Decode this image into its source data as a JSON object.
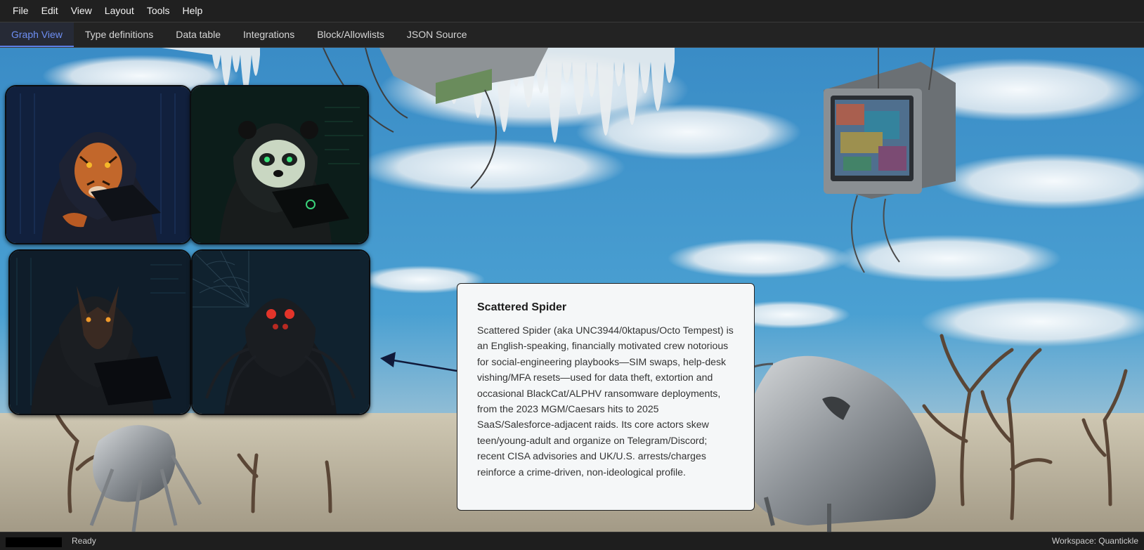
{
  "menu": [
    "File",
    "Edit",
    "View",
    "Layout",
    "Tools",
    "Help"
  ],
  "tabs": [
    {
      "label": "Graph View",
      "active": true
    },
    {
      "label": "Type definitions",
      "active": false
    },
    {
      "label": "Data table",
      "active": false
    },
    {
      "label": "Integrations",
      "active": false
    },
    {
      "label": "Block/Allowlists",
      "active": false
    },
    {
      "label": "JSON Source",
      "active": false
    }
  ],
  "nodes": [
    {
      "name": "tiger-node",
      "icon": "hooded-tiger-hacker-icon"
    },
    {
      "name": "panda-node",
      "icon": "hooded-panda-hacker-icon"
    },
    {
      "name": "wolf-node",
      "icon": "hooded-wolf-hacker-icon"
    },
    {
      "name": "spider-node",
      "icon": "hooded-spider-hacker-icon"
    }
  ],
  "tooltip": {
    "title": "Scattered Spider",
    "body": "Scattered Spider (aka UNC3944/0ktapus/Octo Tempest) is an English-speaking, financially motivated crew notorious for social-engineering playbooks—SIM swaps, help-desk vishing/MFA resets—used for data theft, extortion and occasional BlackCat/ALPHV ransomware deployments, from the 2023 MGM/Caesars hits to 2025 SaaS/Salesforce-adjacent raids. Its core actors skew teen/young-adult and organize on Telegram/Discord; recent CISA advisories and UK/U.S. arrests/charges reinforce a crime-driven, non-ideological profile."
  },
  "status": {
    "text": "Ready",
    "workspace": "Workspace: Quantickle"
  },
  "colors": {
    "active_tab": "#6e8ff4",
    "sky": "#2f86c4",
    "ground": "#b9b3a4"
  }
}
